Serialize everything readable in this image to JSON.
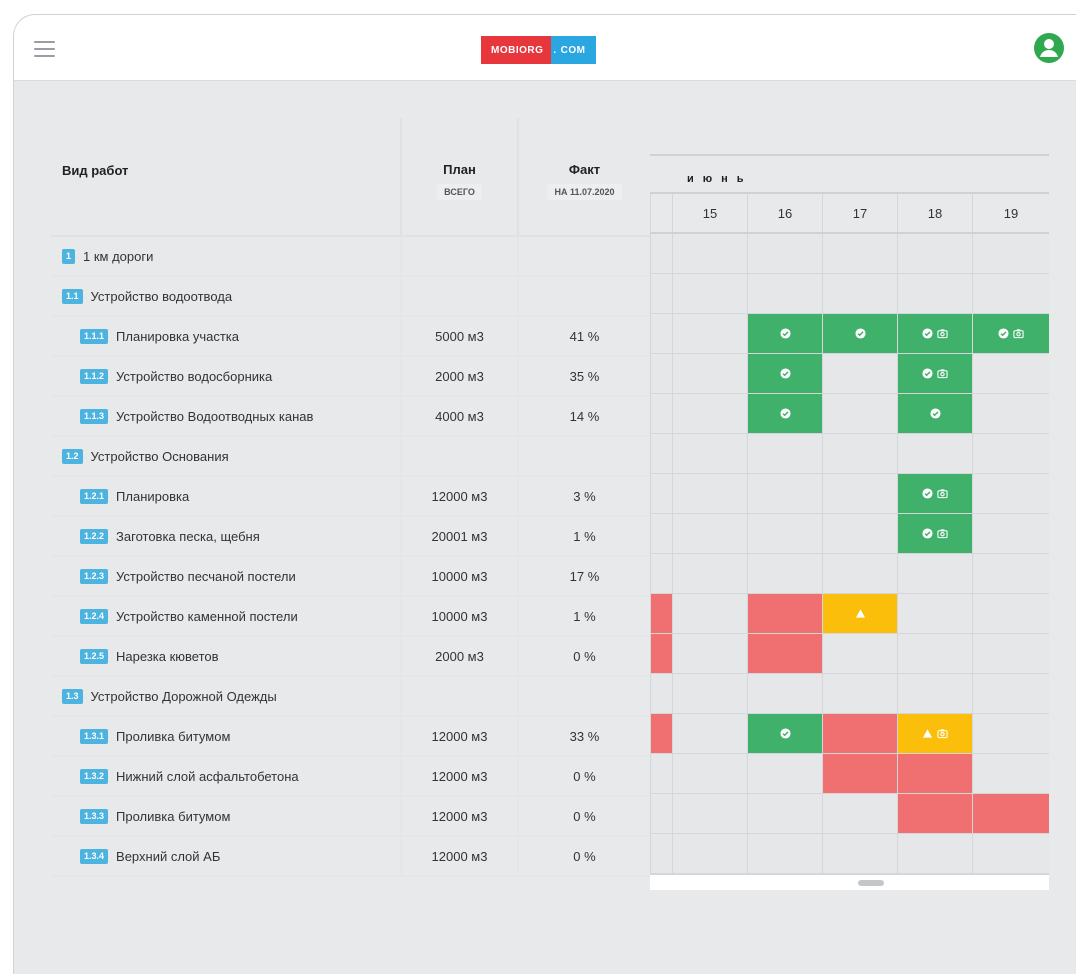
{
  "header": {
    "logo_part1": "MOBIORG",
    "logo_dot": ".",
    "logo_part2": "COM"
  },
  "table": {
    "col_work": "Вид работ",
    "col_plan": "План",
    "col_plan_sub": "ВСЕГО",
    "col_fact": "Факт",
    "col_fact_sub": "НА 11.07.2020",
    "month": "июнь",
    "days": [
      "15",
      "16",
      "17",
      "18",
      "19"
    ],
    "rows": [
      {
        "code": "1",
        "name": "1 км дороги",
        "plan": "",
        "fact": "",
        "level": 0,
        "cells": [
          "",
          "",
          "",
          "",
          "",
          ""
        ]
      },
      {
        "code": "1.1",
        "name": "Устройство водоотвода",
        "plan": "",
        "fact": "",
        "level": 1,
        "cells": [
          "",
          "",
          "",
          "",
          "",
          ""
        ]
      },
      {
        "code": "1.1.1",
        "name": "Планировка участка",
        "plan": "5000 м3",
        "fact": "41 %",
        "level": 2,
        "cells": [
          "",
          "",
          "check",
          "check",
          "check-photo",
          "check-photo"
        ]
      },
      {
        "code": "1.1.2",
        "name": "Устройство водосборника",
        "plan": "2000 м3",
        "fact": "35 %",
        "level": 2,
        "cells": [
          "",
          "",
          "check",
          "",
          "check-photo",
          ""
        ]
      },
      {
        "code": "1.1.3",
        "name": "Устройство Водоотводных канав",
        "plan": "4000 м3",
        "fact": "14 %",
        "level": 2,
        "cells": [
          "",
          "",
          "check",
          "",
          "check",
          ""
        ]
      },
      {
        "code": "1.2",
        "name": "Устройство Основания",
        "plan": "",
        "fact": "",
        "level": 1,
        "cells": [
          "",
          "",
          "",
          "",
          "",
          ""
        ]
      },
      {
        "code": "1.2.1",
        "name": "Планировка",
        "plan": "12000 м3",
        "fact": "3 %",
        "level": 2,
        "cells": [
          "",
          "",
          "",
          "",
          "check-photo",
          ""
        ]
      },
      {
        "code": "1.2.2",
        "name": "Заготовка песка, щебня",
        "plan": "20001 м3",
        "fact": "1 %",
        "level": 2,
        "cells": [
          "",
          "",
          "",
          "",
          "check-photo",
          ""
        ]
      },
      {
        "code": "1.2.3",
        "name": "Устройство песчаной постели",
        "plan": "10000 м3",
        "fact": "17 %",
        "level": 2,
        "cells": [
          "",
          "",
          "",
          "",
          "",
          ""
        ]
      },
      {
        "code": "1.2.4",
        "name": "Устройство каменной постели",
        "plan": "10000 м3",
        "fact": "1 %",
        "level": 2,
        "cells": [
          "red",
          "",
          "red",
          "warn",
          "",
          ""
        ]
      },
      {
        "code": "1.2.5",
        "name": "Нарезка кюветов",
        "plan": "2000 м3",
        "fact": "0 %",
        "level": 2,
        "cells": [
          "red",
          "",
          "red",
          "",
          "",
          ""
        ]
      },
      {
        "code": "1.3",
        "name": "Устройство Дорожной Одежды",
        "plan": "",
        "fact": "",
        "level": 1,
        "cells": [
          "",
          "",
          "",
          "",
          "",
          ""
        ]
      },
      {
        "code": "1.3.1",
        "name": "Проливка битумом",
        "plan": "12000 м3",
        "fact": "33 %",
        "level": 2,
        "cells": [
          "red",
          "",
          "check",
          "red",
          "warn-photo",
          ""
        ]
      },
      {
        "code": "1.3.2",
        "name": "Нижний слой асфальтобетона",
        "plan": "12000 м3",
        "fact": "0 %",
        "level": 2,
        "cells": [
          "",
          "",
          "",
          "red",
          "red",
          ""
        ]
      },
      {
        "code": "1.3.3",
        "name": "Проливка битумом",
        "plan": "12000 м3",
        "fact": "0 %",
        "level": 2,
        "cells": [
          "",
          "",
          "",
          "",
          "red",
          "red"
        ]
      },
      {
        "code": "1.3.4",
        "name": "Верхний слой АБ",
        "plan": "12000 м3",
        "fact": "0 %",
        "level": 2,
        "cells": [
          "",
          "",
          "",
          "",
          "",
          ""
        ]
      }
    ]
  },
  "colors": {
    "done": "#3fb16a",
    "overdue": "#f06f70",
    "warning": "#fbbe0a",
    "badge": "#4db3df"
  }
}
